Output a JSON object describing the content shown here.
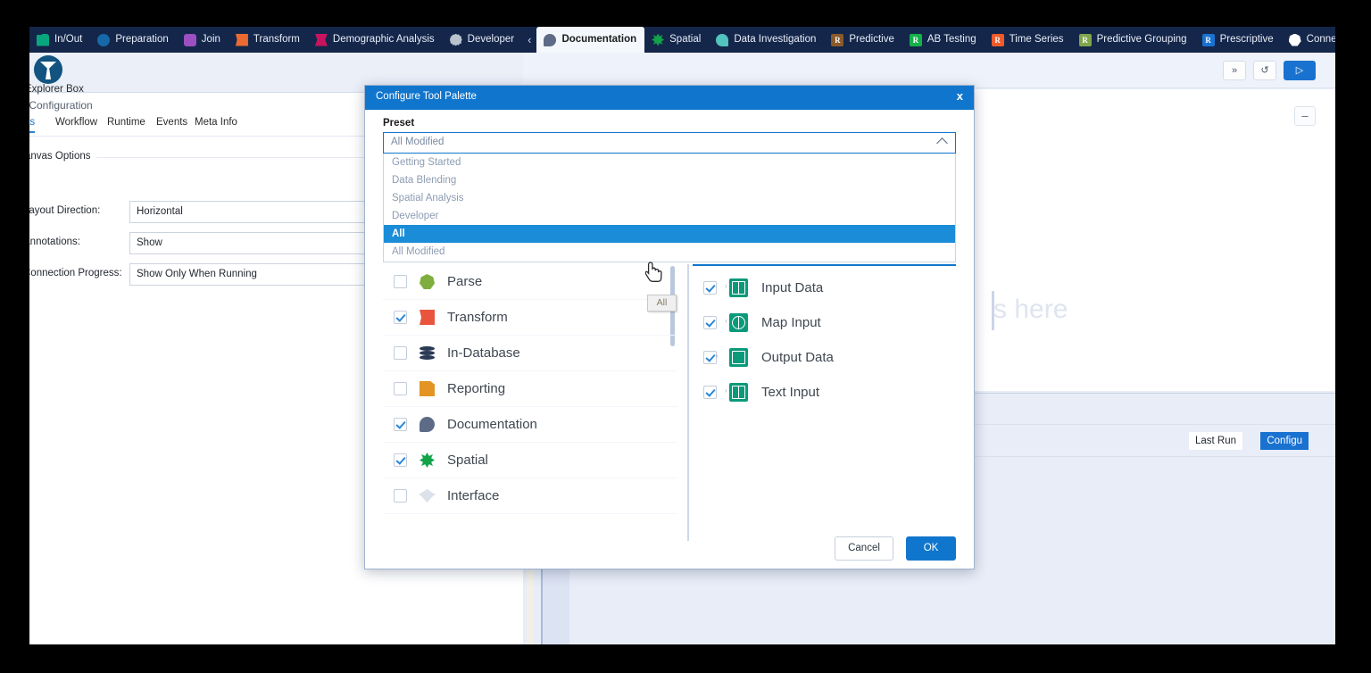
{
  "ribbon": {
    "collapse_icon": "chevron-left-icon",
    "categories": [
      {
        "label": "In/Out",
        "icon": "folder-icon",
        "shape": "folder",
        "color": "#09a57e",
        "active": false
      },
      {
        "label": "Preparation",
        "icon": "circle-icon",
        "shape": "circle",
        "color": "#1569a8",
        "active": false
      },
      {
        "label": "Join",
        "icon": "square-icon",
        "shape": "square",
        "color": "#9b4fc0",
        "active": false
      },
      {
        "label": "Transform",
        "icon": "ribbon-icon",
        "shape": "ribbon",
        "color": "#ea6a32",
        "active": false
      },
      {
        "label": "Demographic Analysis",
        "icon": "bowtie-icon",
        "shape": "bowtie",
        "color": "#c8145e",
        "active": false
      },
      {
        "label": "Developer",
        "icon": "gear-icon",
        "shape": "gear",
        "color": "#b9c4cf",
        "active": false
      },
      {
        "label": "Documentation",
        "icon": "speech-bubble-icon",
        "shape": "speech",
        "color": "#5d6b86",
        "active": true
      },
      {
        "label": "Spatial",
        "icon": "star-icon",
        "shape": "star",
        "color": "#12a34a",
        "active": false
      },
      {
        "label": "Data Investigation",
        "icon": "magnifier-icon",
        "shape": "magnify",
        "color": "#52c3bd",
        "active": false
      },
      {
        "label": "Predictive",
        "icon": "r-badge-icon",
        "shape": "r",
        "color": "#8a5a2b",
        "active": false
      },
      {
        "label": "AB Testing",
        "icon": "r-badge-icon",
        "shape": "r",
        "color": "#14b14b",
        "active": false
      },
      {
        "label": "Time Series",
        "icon": "r-badge-icon",
        "shape": "r",
        "color": "#f05a28",
        "active": false
      },
      {
        "label": "Predictive Grouping",
        "icon": "r-badge-icon",
        "shape": "r",
        "color": "#7fa64a",
        "active": false
      },
      {
        "label": "Prescriptive",
        "icon": "r-badge-icon",
        "shape": "r",
        "color": "#1a72d0",
        "active": false
      },
      {
        "label": "Connectors",
        "icon": "heptagon-icon",
        "shape": "hept",
        "color": "#ffffff",
        "active": false
      }
    ]
  },
  "left_panel": {
    "tool_name": "Explorer Box",
    "config_title": "- Configuration",
    "tabs": [
      {
        "label": "as",
        "active": true
      },
      {
        "label": "Workflow",
        "active": false
      },
      {
        "label": "Runtime",
        "active": false
      },
      {
        "label": "Events",
        "active": false
      },
      {
        "label": "Meta Info",
        "active": false
      }
    ],
    "section_legend": "anvas Options",
    "fields": [
      {
        "label": "Layout Direction:",
        "value": "Horizontal"
      },
      {
        "label": "Annotations:",
        "value": "Show"
      },
      {
        "label": "Connection Progress:",
        "value": "Show Only When Running"
      }
    ]
  },
  "workspace": {
    "toolbar_buttons": [
      {
        "name": "expand-more-button",
        "glyph": "»",
        "primary": false
      },
      {
        "name": "history-button",
        "glyph": "↺",
        "primary": false
      },
      {
        "name": "run-button",
        "glyph": "▷",
        "primary": true
      }
    ],
    "canvas_placeholder": "s here",
    "zoom_out_label": "–",
    "results_tabs": [
      {
        "label": "Last Run",
        "active": false
      },
      {
        "label": "Configu",
        "active": true
      }
    ]
  },
  "dialog": {
    "title": "Configure Tool Palette",
    "close_label": "x",
    "preset_label": "Preset",
    "preset_value": "All Modified",
    "preset_options": [
      {
        "label": "Getting Started",
        "selected": false
      },
      {
        "label": "Data Blending",
        "selected": false
      },
      {
        "label": "Spatial Analysis",
        "selected": false
      },
      {
        "label": "Developer",
        "selected": false
      },
      {
        "label": "All",
        "selected": true
      },
      {
        "label": "All Modified",
        "selected": false
      }
    ],
    "categories": [
      {
        "label": "Parse",
        "checked": false,
        "icon": "hexagon-icon",
        "shape": "hept",
        "color": "#7fae3f"
      },
      {
        "label": "Transform",
        "checked": true,
        "icon": "ribbon-icon",
        "shape": "ribbon",
        "color": "#e8553c"
      },
      {
        "label": "In-Database",
        "checked": false,
        "icon": "database-icon",
        "shape": "db",
        "color": "#2b3a55"
      },
      {
        "label": "Reporting",
        "checked": false,
        "icon": "document-icon",
        "shape": "doc",
        "color": "#e39423"
      },
      {
        "label": "Documentation",
        "checked": true,
        "icon": "speech-bubble-icon",
        "shape": "speech",
        "color": "#5d6b86"
      },
      {
        "label": "Spatial",
        "checked": true,
        "icon": "star-icon",
        "shape": "star",
        "color": "#12a34a"
      },
      {
        "label": "Interface",
        "checked": false,
        "icon": "diamond-icon",
        "shape": "diamond",
        "color": "#dbe2ea"
      }
    ],
    "tools": [
      {
        "label": "Input Data",
        "checked": true,
        "icon": "book-icon",
        "shape": "book",
        "caret_before": false
      },
      {
        "label": "Map Input",
        "checked": true,
        "icon": "globe-icon",
        "shape": "globe",
        "caret_before": false
      },
      {
        "label": "Output Data",
        "checked": true,
        "icon": "document-edit-icon",
        "shape": "docedit",
        "caret_before": true
      },
      {
        "label": "Text Input",
        "checked": true,
        "icon": "book-icon",
        "shape": "book",
        "caret_before": false
      }
    ],
    "cancel_label": "Cancel",
    "ok_label": "OK"
  },
  "tooltip": {
    "text": "All"
  },
  "colors": {
    "ribbon_bg": "#14264a",
    "dialog_accent": "#1076cd",
    "selection": "#1a8cd8",
    "app_bg": "#e8edf7"
  }
}
